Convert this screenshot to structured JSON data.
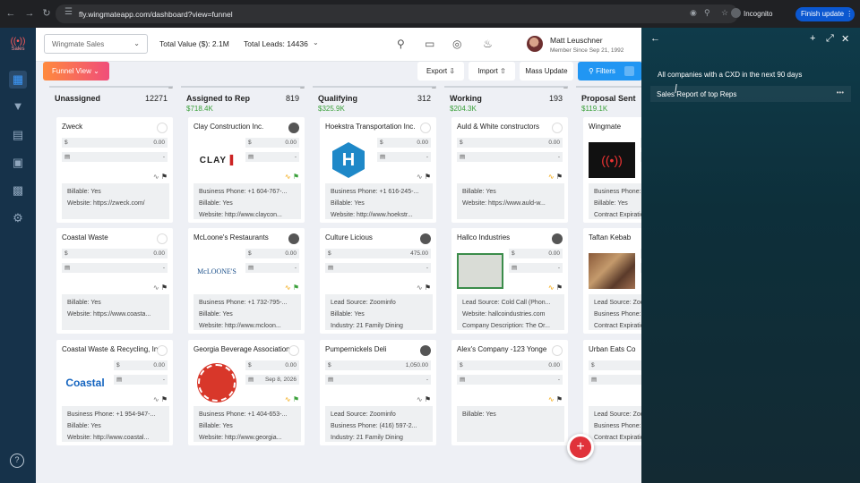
{
  "browser": {
    "url": "fly.wingmateapp.com/dashboard?view=funnel",
    "incognito": "Incognito",
    "finish_update": "Finish update"
  },
  "rail": {
    "logo_label": "Sales"
  },
  "topbar": {
    "pipeline_select": "Wingmate Sales",
    "total_value": "Total Value ($): 2.1M",
    "total_leads": "Total Leads: 14436",
    "user_name": "Matt Leuschner",
    "user_since": "Member Since Sep 21, 1992"
  },
  "toolbar": {
    "funnel_view": "Funnel View",
    "export": "Export",
    "import": "Import",
    "mass_update": "Mass Update",
    "filters": "Filters"
  },
  "columns": [
    {
      "name": "Unassigned",
      "count": "12271",
      "amount": "",
      "cards": [
        {
          "name": "Zweck",
          "value": "0.00",
          "date": "-",
          "avatar": "ghost",
          "info": [
            "Billable: Yes",
            "Website: https://zweck.com/"
          ]
        },
        {
          "name": "Coastal Waste",
          "value": "0.00",
          "date": "-",
          "avatar": "ghost",
          "info": [
            "Billable: Yes",
            "Website: https://www.coasta..."
          ]
        },
        {
          "name": "Coastal Waste & Recycling, Inc",
          "value": "0.00",
          "date": "-",
          "avatar": "ghost",
          "logo": "Coastal",
          "info": [
            "Business Phone: +1 954-947-...",
            "Billable: Yes",
            "Website: http://www.coastal..."
          ]
        }
      ]
    },
    {
      "name": "Assigned to Rep",
      "count": "819",
      "amount": "$718.4K",
      "cards": [
        {
          "name": "Clay Construction Inc.",
          "value": "0.00",
          "date": "-",
          "avatar": "person",
          "logo": "CLAY",
          "info": [
            "Business Phone: +1 604-767-...",
            "Billable: Yes",
            "Website: http://www.claycon..."
          ]
        },
        {
          "name": "McLoone's Restaurants",
          "value": "0.00",
          "date": "-",
          "avatar": "person",
          "logo": "McLOONE'S",
          "info": [
            "Business Phone: +1 732-795-...",
            "Billable: Yes",
            "Website: http://www.mcloon..."
          ]
        },
        {
          "name": "Georgia Beverage Association",
          "value": "0.00",
          "date": "Sep 8, 2026",
          "avatar": "ghost",
          "logo": "georgia",
          "info": [
            "Business Phone: +1 404-653-...",
            "Billable: Yes",
            "Website: http://www.georgia..."
          ]
        }
      ]
    },
    {
      "name": "Qualifying",
      "count": "312",
      "amount": "$325.9K",
      "cards": [
        {
          "name": "Hoekstra Transportation Inc.",
          "value": "0.00",
          "date": "-",
          "avatar": "ghost",
          "logo": "H",
          "info": [
            "Business Phone: +1 616-245-...",
            "Billable: Yes",
            "Website: http://www.hoekstr..."
          ]
        },
        {
          "name": "Culture Licious",
          "value": "475.00",
          "date": "-",
          "avatar": "person",
          "info": [
            "Lead Source: Zoominfo",
            "Billable: Yes",
            "Industry: 21 Family Dining"
          ]
        },
        {
          "name": "Pumpernickels Deli",
          "value": "1,050.00",
          "date": "-",
          "avatar": "person",
          "info": [
            "Lead Source: Zoominfo",
            "Business Phone: (416) 597-2...",
            "Industry: 21 Family Dining"
          ]
        }
      ]
    },
    {
      "name": "Working",
      "count": "193",
      "amount": "$204.3K",
      "cards": [
        {
          "name": "Auld & White constructors",
          "value": "0.00",
          "date": "-",
          "avatar": "ghost",
          "info": [
            "Billable: Yes",
            "Website: https://www.auld-w..."
          ]
        },
        {
          "name": "Hallco Industries",
          "value": "0.00",
          "date": "-",
          "avatar": "person",
          "logo": "hallco",
          "info": [
            "Lead Source: Cold Call (Phon...",
            "Website: hallcoindustries.com",
            "Company Description: The Or..."
          ]
        },
        {
          "name": "Alex's Company -123 Yonge",
          "value": "0.00",
          "date": "-",
          "avatar": "ghost",
          "info": [
            "Billable: Yes"
          ]
        }
      ]
    },
    {
      "name": "Proposal Sent",
      "count": "",
      "amount": "$119.1K",
      "cards": [
        {
          "name": "Wingmate",
          "value": "",
          "date": "",
          "avatar": "none",
          "logo": "wingmate",
          "info": [
            "Business Phone:",
            "Billable: Yes",
            "Contract Expiratio"
          ]
        },
        {
          "name": "Taftan Kebab",
          "value": "",
          "date": "",
          "avatar": "none",
          "logo": "photo",
          "info": [
            "Lead Source: Zoc",
            "Business Phone:",
            "Contract Expiratio"
          ]
        },
        {
          "name": "Urban Eats Co",
          "value": "",
          "date": "",
          "avatar": "none",
          "info": [
            "Lead Source: Zoc",
            "Business Phone:",
            "Contract Expiratio"
          ]
        }
      ]
    }
  ],
  "panel": {
    "items": [
      "All companies with a CXD in the next 90 days",
      "Sales Report of top Reps"
    ]
  },
  "colors": {
    "rail": "#16324a",
    "accent": "#2196f3",
    "amount": "#3aa03a",
    "fab": "#e0323a"
  }
}
